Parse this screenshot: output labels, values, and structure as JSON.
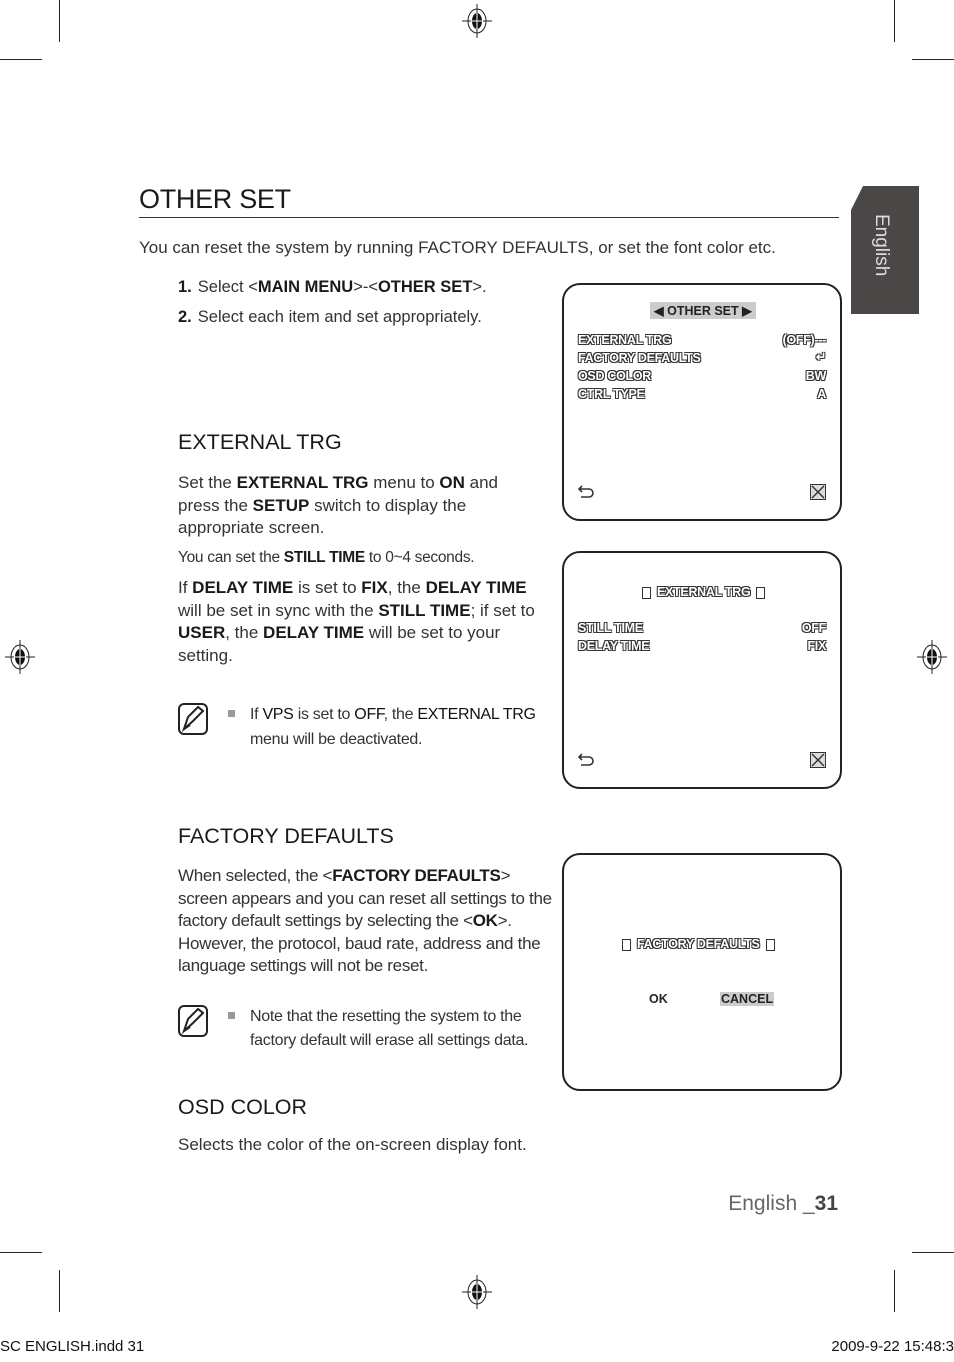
{
  "page": {
    "title": "OTHER SET",
    "intro": "You can reset the system by running FACTORY DEFAULTS, or set the font color etc.",
    "steps": [
      {
        "num": "1.",
        "pre": "Select <",
        "b1": "MAIN MENU",
        "mid": ">-<",
        "b2": "OTHER SET",
        "post": ">."
      },
      {
        "num": "2.",
        "text": "Select each item and set appropriately."
      }
    ],
    "side_tab": "English",
    "page_number": {
      "prefix": "English _",
      "number": "31"
    },
    "slug": {
      "left": "SC ENGLISH.indd   31",
      "right": "2009-9-22   15:48:3"
    }
  },
  "external_trg": {
    "heading": "EXTERNAL TRG",
    "p1": {
      "t1": "Set the ",
      "b1": "EXTERNAL TRG",
      "t2": " menu to ",
      "b2": "ON",
      "t3": " and press the ",
      "b3": "SETUP",
      "t4": " switch to display the appropriate screen."
    },
    "p2": {
      "t1": "You can set the ",
      "b1": "STILL TIME",
      "t2": " to 0~4 seconds."
    },
    "p3": {
      "t1": "If ",
      "b1": "DELAY TIME",
      "t2": " is set to ",
      "b2": "FIX",
      "t3": ", the ",
      "b3": "DELAY TIME",
      "t4": " will be set in sync with the ",
      "b4": "STILL TIME",
      "t5": "; if set to ",
      "b5": "USER",
      "t6": ", the ",
      "b6": "DELAY TIME",
      "t7": " will be set to your setting."
    },
    "note": {
      "t1": "If ",
      "b1": "VPS",
      "t2": " is set to ",
      "b2": "OFF",
      "t3": ", the ",
      "b3": "EXTERNAL TRG",
      "t4": " menu will be deactivated."
    }
  },
  "factory_defaults": {
    "heading": "FACTORY DEFAULTS",
    "p1": {
      "t1": "When selected, the <",
      "b1": "FACTORY DEFAULTS",
      "t2": "> screen appears and you can reset all settings to the factory default settings by selecting the <",
      "b2": "OK",
      "t3": ">. However, the protocol, baud rate, address and the language settings will not be reset."
    },
    "note": "Note that the resetting the system to the factory default will erase all settings data."
  },
  "osd_color": {
    "heading": "OSD COLOR",
    "text": "Selects the color of the on-screen display font."
  },
  "screens": {
    "other_set": {
      "header": "OTHER SET",
      "rows": [
        {
          "label": "EXTERNAL TRG",
          "value": "(OFF)---"
        },
        {
          "label": "FACTORY DEFAULTS",
          "value": "↵"
        },
        {
          "label": "OSD COLOR",
          "value": "BW"
        },
        {
          "label": "CTRL TYPE",
          "value": "A"
        }
      ]
    },
    "external_trg": {
      "header": "EXTERNAL TRG",
      "rows": [
        {
          "label": "STILL TIME",
          "value": "OFF"
        },
        {
          "label": "DELAY TIME",
          "value": "FIX"
        }
      ]
    },
    "factory_defaults": {
      "header": "FACTORY DEFAULTS",
      "ok": "OK",
      "cancel": "CANCEL"
    }
  }
}
